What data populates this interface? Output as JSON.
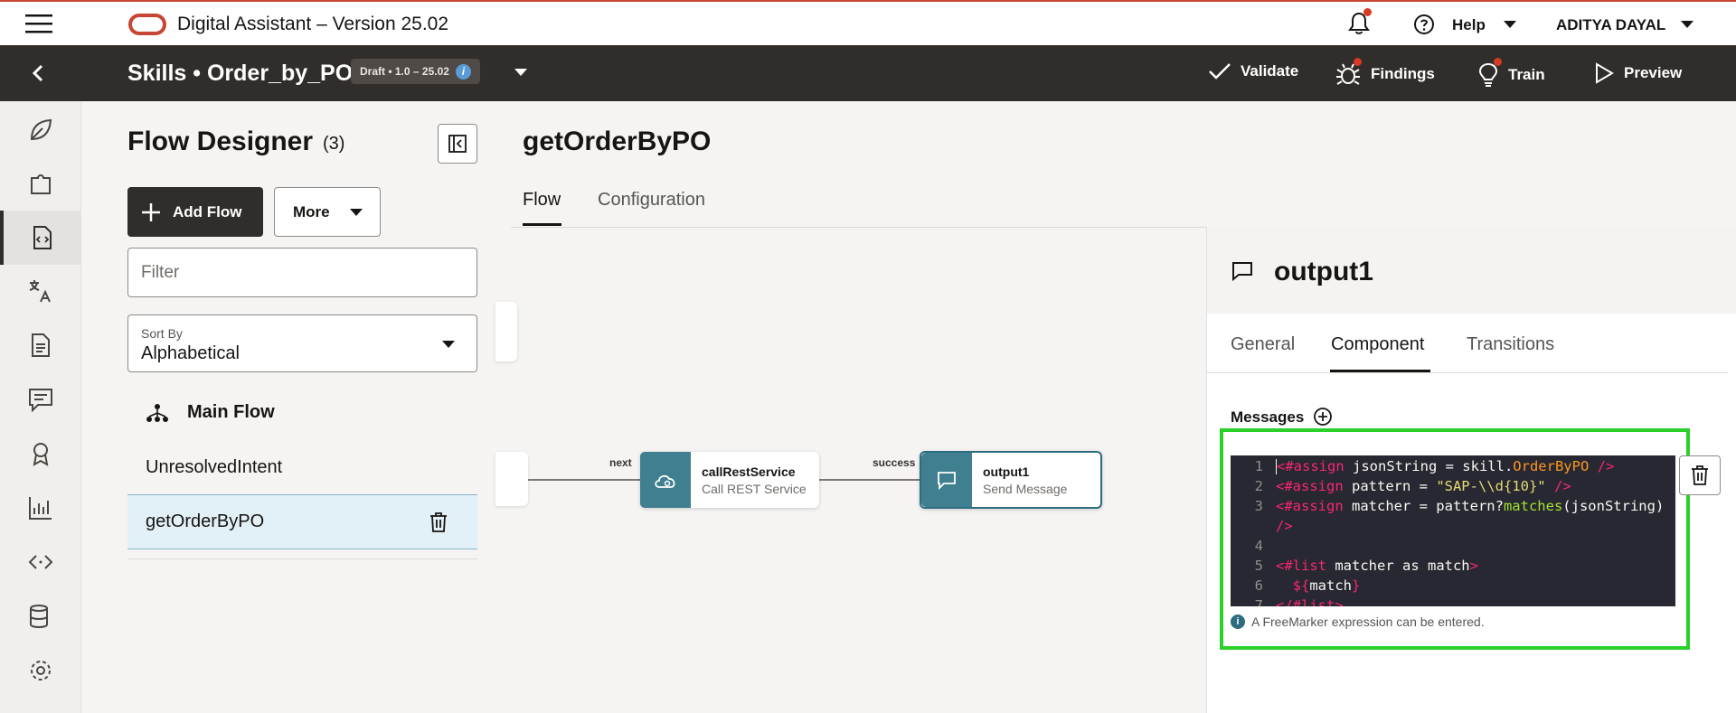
{
  "app": {
    "title": "Digital Assistant – Version 25.02",
    "help_label": "Help",
    "user_name": "ADITYA DAYAL"
  },
  "skill": {
    "title": "Skills • Order_by_PO",
    "badge": "Draft • 1.0 – 25.02",
    "actions": [
      {
        "label": "Validate",
        "icon": "check-icon"
      },
      {
        "label": "Findings",
        "icon": "bug-icon"
      },
      {
        "label": "Train",
        "icon": "lightbulb-icon"
      },
      {
        "label": "Preview",
        "icon": "play-icon"
      }
    ]
  },
  "rail": {
    "items": [
      "leaf-icon",
      "puzzle-icon",
      "flow-designer-icon",
      "translate-icon",
      "document-icon",
      "chat-icon",
      "award-icon",
      "chart-icon",
      "code-icon",
      "database-icon",
      "gear-icon"
    ],
    "active": "flow-designer-icon"
  },
  "flows_panel": {
    "title": "Flow Designer",
    "count": "(3)",
    "add_flow_label": "Add Flow",
    "more_label": "More",
    "filter_placeholder": "Filter",
    "sort_label": "Sort By",
    "sort_value": "Alphabetical",
    "items": [
      {
        "label": "Main Flow",
        "type": "main"
      },
      {
        "label": "UnresolvedIntent",
        "type": "normal"
      },
      {
        "label": "getOrderByPO",
        "type": "selected"
      }
    ]
  },
  "flow": {
    "title": "getOrderByPO",
    "tabs": [
      "Flow",
      "Configuration"
    ],
    "active_tab": "Flow",
    "edges": [
      "next",
      "success"
    ],
    "nodes": [
      {
        "name": "callRestService",
        "subtitle": "Call REST Service",
        "icon": "cloud-gear-icon"
      },
      {
        "name": "output1",
        "subtitle": "Send Message",
        "icon": "message-icon"
      }
    ]
  },
  "properties": {
    "title": "output1",
    "tabs": [
      "General",
      "Component",
      "Transitions"
    ],
    "active_tab": "Component",
    "messages_label": "Messages",
    "hint": "A FreeMarker expression can be entered.",
    "code_lines": [
      "1",
      "2",
      "3",
      "4",
      "5",
      "6",
      "7"
    ]
  },
  "colors": {
    "brand_red": "#c74634",
    "header_dark": "#312d2a",
    "node_teal": "#3f7f8f",
    "highlight_green": "#2bd12b",
    "editor_bg": "#272831"
  }
}
